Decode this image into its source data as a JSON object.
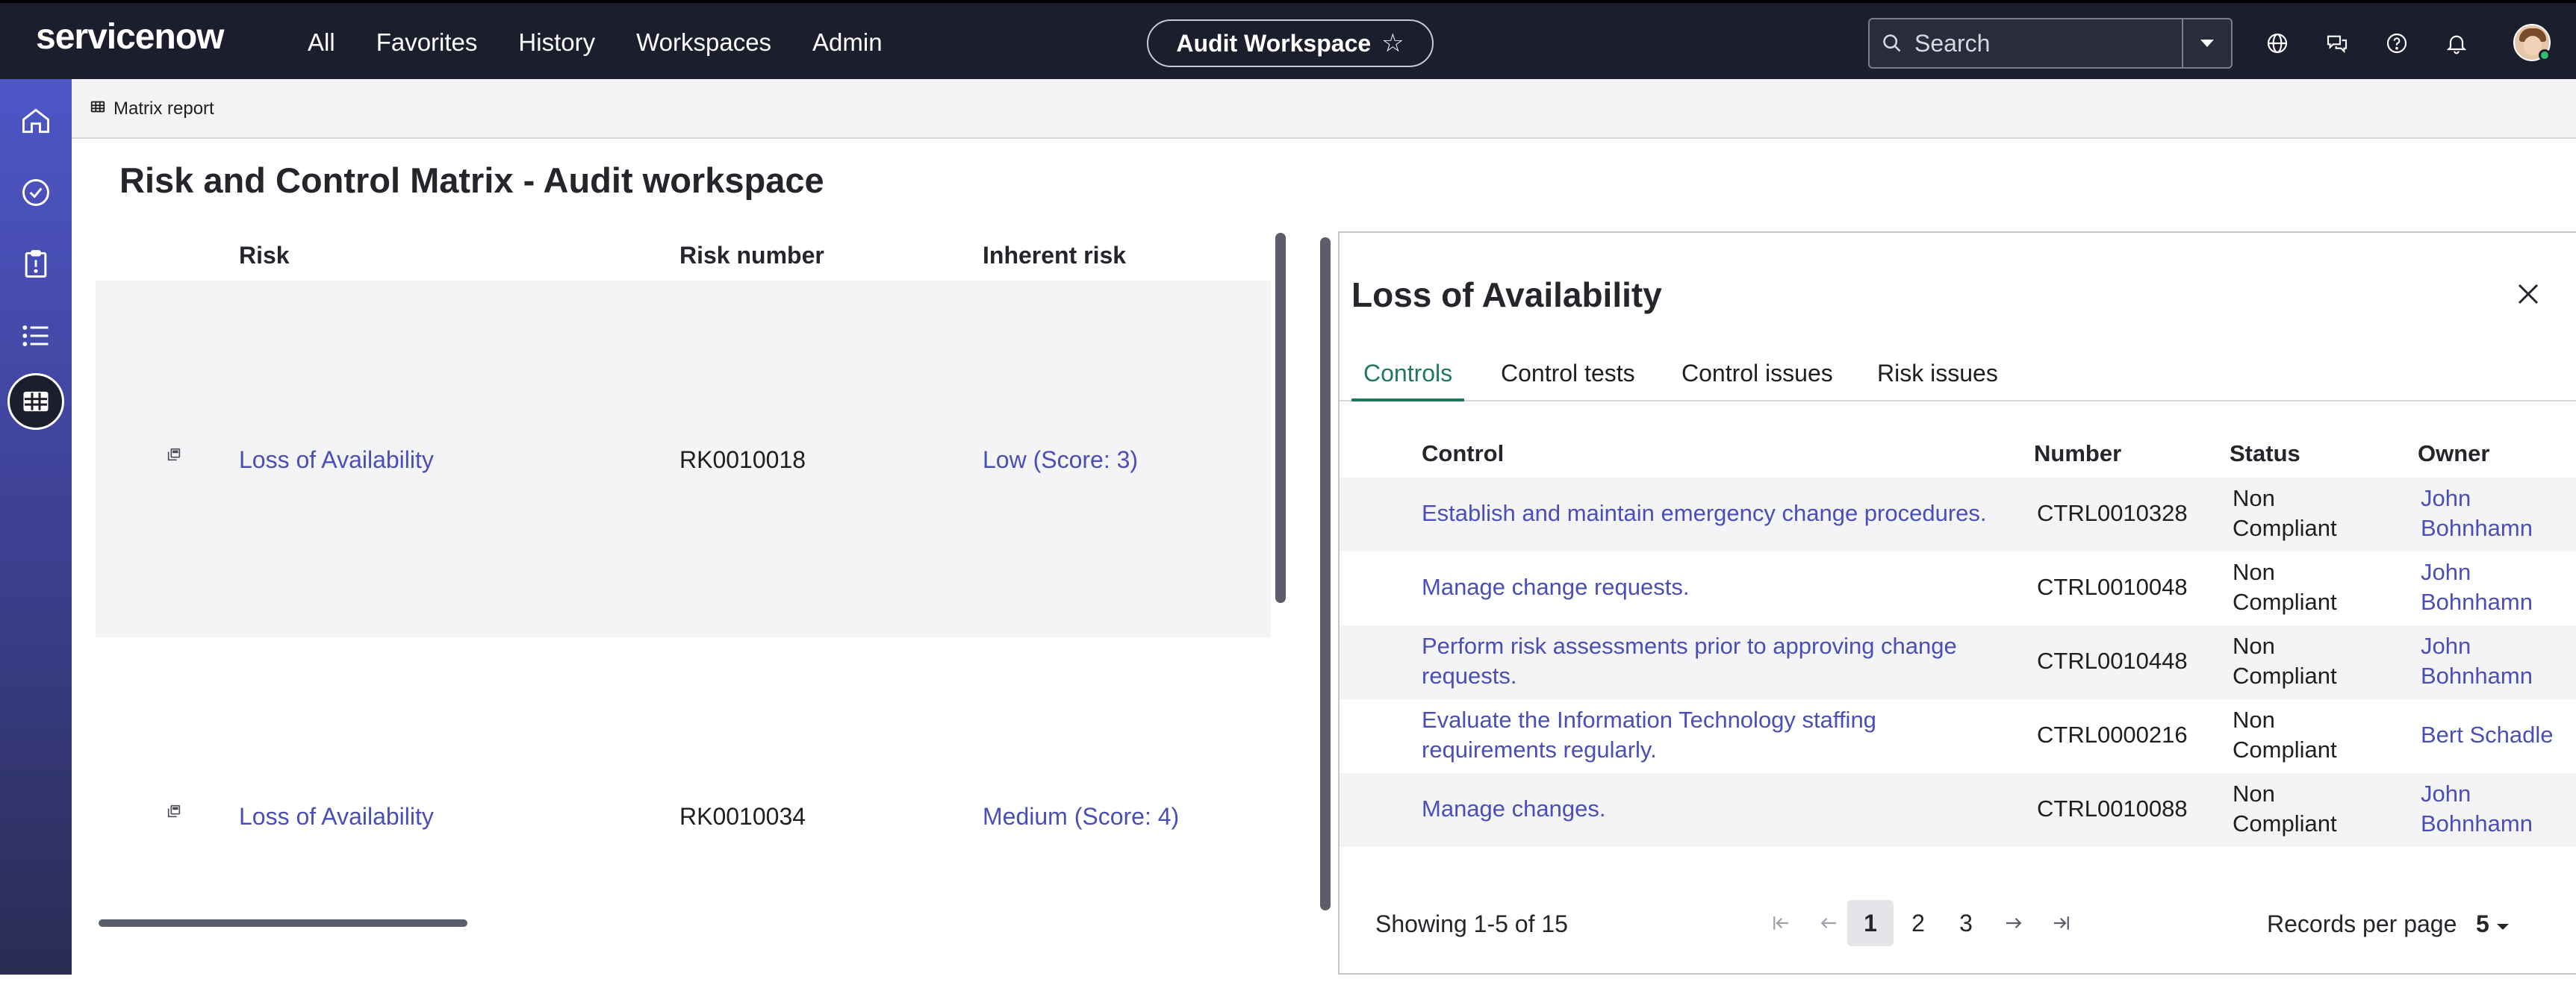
{
  "topnav": {
    "logo": "servicenow",
    "items": [
      "All",
      "Favorites",
      "History",
      "Workspaces",
      "Admin"
    ],
    "workspace_label": "Audit Workspace",
    "search_placeholder": "Search"
  },
  "tabstrip": {
    "tab_label": "Matrix report"
  },
  "page": {
    "title": "Risk and Control Matrix - Audit workspace"
  },
  "matrix": {
    "headers": {
      "risk": "Risk",
      "risk_number": "Risk number",
      "inherent_risk": "Inherent risk"
    },
    "rows": [
      {
        "risk": "Loss of Availability",
        "number": "RK0010018",
        "inherent": "Low (Score: 3)"
      },
      {
        "risk": "Loss of Availability",
        "number": "RK0010034",
        "inherent": "Medium (Score: 4)"
      }
    ]
  },
  "panel": {
    "title": "Loss of Availability",
    "tabs": [
      "Controls",
      "Control tests",
      "Control issues",
      "Risk issues"
    ],
    "headers": {
      "control": "Control",
      "number": "Number",
      "status": "Status",
      "owner": "Owner"
    },
    "rows": [
      {
        "control_l1": "Establish and maintain emergency change procedures.",
        "control_l2": "",
        "number": "CTRL0010328",
        "status_l1": "Non",
        "status_l2": "Compliant",
        "owner_l1": "John",
        "owner_l2": "Bohnhamn"
      },
      {
        "control_l1": "Manage change requests.",
        "control_l2": "",
        "number": "CTRL0010048",
        "status_l1": "Non",
        "status_l2": "Compliant",
        "owner_l1": "John",
        "owner_l2": "Bohnhamn"
      },
      {
        "control_l1": "Perform risk assessments prior to approving change",
        "control_l2": "requests.",
        "number": "CTRL0010448",
        "status_l1": "Non",
        "status_l2": "Compliant",
        "owner_l1": "John",
        "owner_l2": "Bohnhamn"
      },
      {
        "control_l1": "Evaluate the Information Technology staffing",
        "control_l2": "requirements regularly.",
        "number": "CTRL0000216",
        "status_l1": "Non",
        "status_l2": "Compliant",
        "owner_l1": "Bert Schadle",
        "owner_l2": ""
      },
      {
        "control_l1": "Manage changes.",
        "control_l2": "",
        "number": "CTRL0010088",
        "status_l1": "Non",
        "status_l2": "Compliant",
        "owner_l1": "John",
        "owner_l2": "Bohnhamn"
      }
    ],
    "pagination": {
      "showing": "Showing 1-5 of 15",
      "pages": [
        "1",
        "2",
        "3"
      ],
      "current": "1",
      "records_label": "Records per page",
      "records_value": "5"
    }
  },
  "colors": {
    "accent_link": "#4a4fb8",
    "active_tab": "#1f7a55",
    "nav_bg": "#1c1e2e"
  }
}
